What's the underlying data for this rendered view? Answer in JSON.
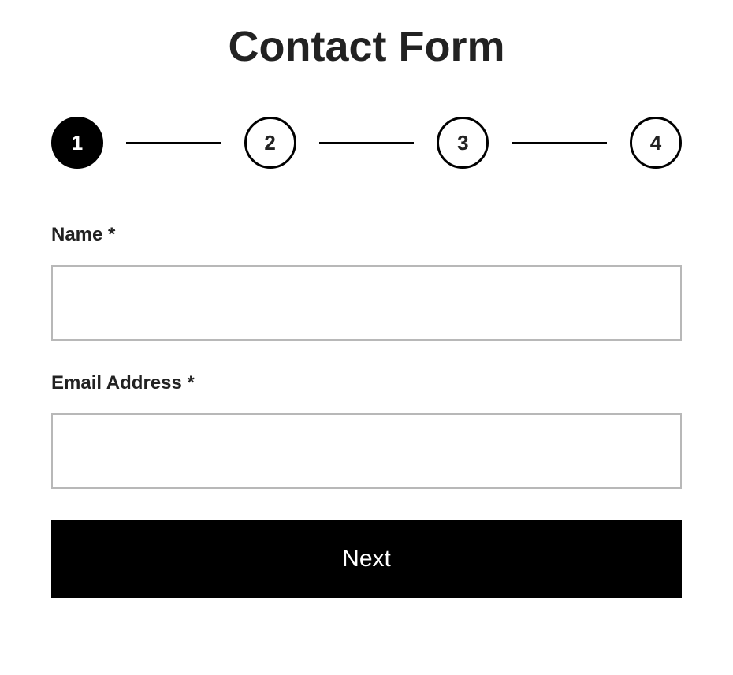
{
  "title": "Contact Form",
  "stepper": {
    "steps": [
      "1",
      "2",
      "3",
      "4"
    ],
    "active_index": 0
  },
  "fields": {
    "name": {
      "label": "Name *",
      "value": ""
    },
    "email": {
      "label": "Email Address *",
      "value": ""
    }
  },
  "next_button_label": "Next"
}
